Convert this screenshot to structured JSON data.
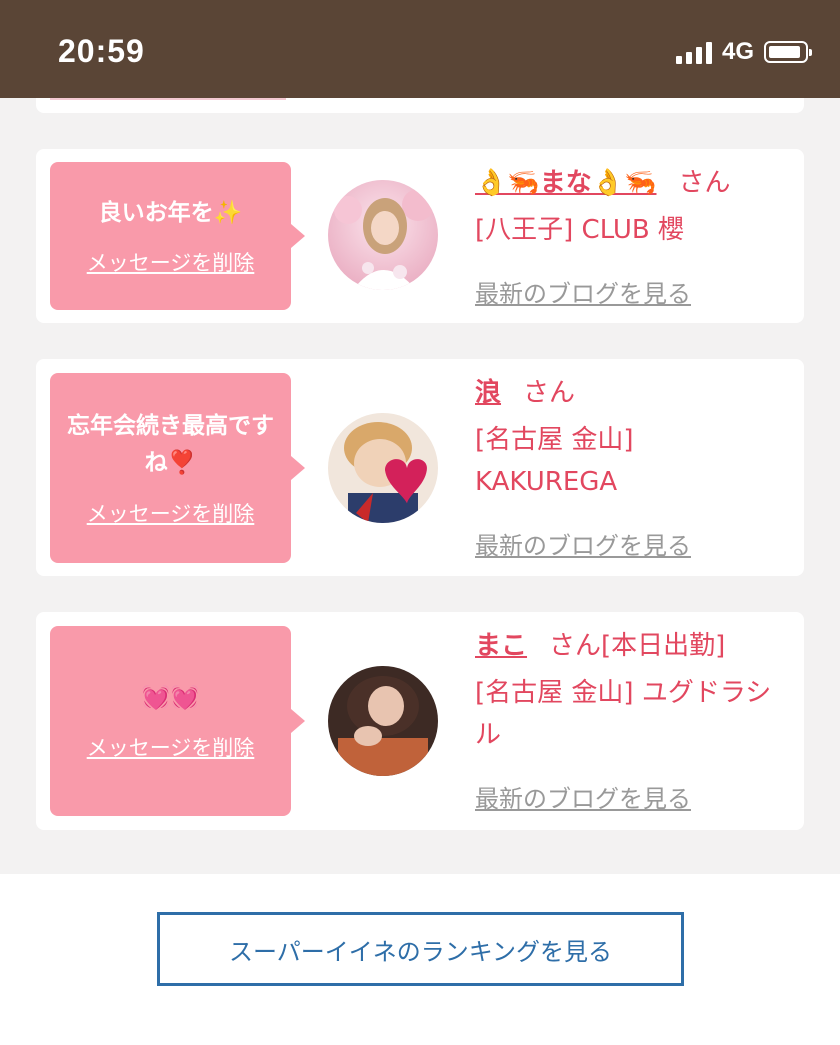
{
  "status_bar": {
    "time": "20:59",
    "network": "4G",
    "battery_level": 0.9,
    "signal_icon": "cellular-signal-icon",
    "battery_icon": "battery-icon"
  },
  "messages": [
    {
      "message": "良いお年を✨",
      "delete_label": "メッセージを削除",
      "name": "👌🦐まな👌🦐",
      "honorific": "さん",
      "shop": "[八王子] CLUB 櫻",
      "blog_link": "最新のブログを見る"
    },
    {
      "message": "忘年会続き最高ですね❣️",
      "delete_label": "メッセージを削除",
      "name": "浪",
      "honorific": "さん",
      "shop": "[名古屋 金山] KAKUREGA",
      "blog_link": "最新のブログを見る"
    },
    {
      "message": "💓💓",
      "delete_label": "メッセージを削除",
      "name": "まこ",
      "honorific": "さん[本日出勤]",
      "shop": "[名古屋 金山] ユグドラシル",
      "blog_link": "最新のブログを見る"
    }
  ],
  "footer": {
    "ranking_button": "スーパーイイネのランキングを見る"
  },
  "colors": {
    "status_bar_bg": "#5a4536",
    "bubble_bg": "#f99aaa",
    "accent_pink": "#e2475f",
    "button_blue": "#2e6ea8"
  }
}
